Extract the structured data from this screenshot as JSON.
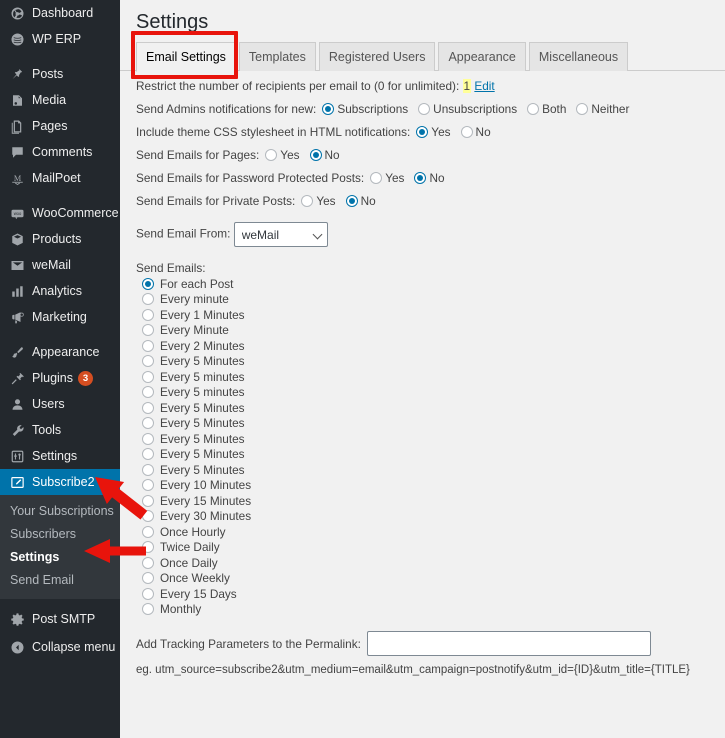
{
  "sidebar": {
    "items": [
      {
        "label": "Dashboard",
        "icon": "dashboard-icon",
        "badge": null
      },
      {
        "label": "WP ERP",
        "icon": "wperp-icon",
        "badge": null
      },
      {
        "sep": true
      },
      {
        "label": "Posts",
        "icon": "pin-icon",
        "badge": null
      },
      {
        "label": "Media",
        "icon": "media-icon",
        "badge": null
      },
      {
        "label": "Pages",
        "icon": "pages-icon",
        "badge": null
      },
      {
        "label": "Comments",
        "icon": "comments-icon",
        "badge": null
      },
      {
        "label": "MailPoet",
        "icon": "mailpoet-icon",
        "badge": null
      },
      {
        "sep": true
      },
      {
        "label": "WooCommerce",
        "icon": "woocommerce-icon",
        "badge": null
      },
      {
        "label": "Products",
        "icon": "products-icon",
        "badge": null
      },
      {
        "label": "weMail",
        "icon": "envelope-icon",
        "badge": null
      },
      {
        "label": "Analytics",
        "icon": "chart-bars-icon",
        "badge": null
      },
      {
        "label": "Marketing",
        "icon": "megaphone-icon",
        "badge": null
      },
      {
        "sep": true
      },
      {
        "label": "Appearance",
        "icon": "paintbrush-icon",
        "badge": null
      },
      {
        "label": "Plugins",
        "icon": "plug-icon",
        "badge": "3"
      },
      {
        "label": "Users",
        "icon": "user-icon",
        "badge": null
      },
      {
        "label": "Tools",
        "icon": "wrench-icon",
        "badge": null
      },
      {
        "label": "Settings",
        "icon": "sliders-icon",
        "badge": null
      },
      {
        "label": "Subscribe2",
        "icon": "pencil-square-icon",
        "badge": null,
        "current": true
      }
    ],
    "submenu": [
      {
        "label": "Your Subscriptions",
        "current": false
      },
      {
        "label": "Subscribers",
        "current": false
      },
      {
        "label": "Settings",
        "current": true
      },
      {
        "label": "Send Email",
        "current": false
      }
    ],
    "footer_items": [
      {
        "label": "Post SMTP",
        "icon": "gear-icon"
      },
      {
        "label": "Collapse menu",
        "icon": "collapse-icon"
      }
    ],
    "colors": {
      "bg": "#23282d",
      "submenu_bg": "#32373c",
      "current": "#0073aa",
      "badge": "#d54e21"
    }
  },
  "header": {
    "title": "Settings"
  },
  "tabs": [
    {
      "label": "Email Settings",
      "active": true
    },
    {
      "label": "Templates",
      "active": false
    },
    {
      "label": "Registered Users",
      "active": false
    },
    {
      "label": "Appearance",
      "active": false
    },
    {
      "label": "Miscellaneous",
      "active": false
    }
  ],
  "restrict": {
    "label": "Restrict the number of recipients per email to (0 for unlimited):",
    "value": "1",
    "edit_label": "Edit"
  },
  "option_rows": [
    {
      "label": "Send Admins notifications for new:",
      "options": [
        {
          "label": "Subscriptions",
          "checked": true
        },
        {
          "label": "Unsubscriptions",
          "checked": false
        },
        {
          "label": "Both",
          "checked": false
        },
        {
          "label": "Neither",
          "checked": false
        }
      ]
    },
    {
      "label": "Include theme CSS stylesheet in HTML notifications:",
      "options": [
        {
          "label": "Yes",
          "checked": true
        },
        {
          "label": "No",
          "checked": false
        }
      ]
    },
    {
      "label": "Send Emails for Pages:",
      "options": [
        {
          "label": "Yes",
          "checked": false
        },
        {
          "label": "No",
          "checked": true
        }
      ]
    },
    {
      "label": "Send Emails for Password Protected Posts:",
      "options": [
        {
          "label": "Yes",
          "checked": false
        },
        {
          "label": "No",
          "checked": true
        }
      ]
    },
    {
      "label": "Send Emails for Private Posts:",
      "options": [
        {
          "label": "Yes",
          "checked": false
        },
        {
          "label": "No",
          "checked": true
        }
      ]
    }
  ],
  "send_email_from": {
    "label": "Send Email From:",
    "selected": "weMail",
    "options": [
      "weMail"
    ]
  },
  "send_emails": {
    "label": "Send Emails:",
    "options": [
      {
        "label": "For each Post",
        "checked": true
      },
      {
        "label": "Every minute",
        "checked": false
      },
      {
        "label": "Every 1 Minutes",
        "checked": false
      },
      {
        "label": "Every Minute",
        "checked": false
      },
      {
        "label": "Every 2 Minutes",
        "checked": false
      },
      {
        "label": "Every 5 Minutes",
        "checked": false
      },
      {
        "label": "Every 5 minutes",
        "checked": false
      },
      {
        "label": "Every 5 minutes",
        "checked": false
      },
      {
        "label": "Every 5 Minutes",
        "checked": false
      },
      {
        "label": "Every 5 Minutes",
        "checked": false
      },
      {
        "label": "Every 5 Minutes",
        "checked": false
      },
      {
        "label": "Every 5 Minutes",
        "checked": false
      },
      {
        "label": "Every 5 Minutes",
        "checked": false
      },
      {
        "label": "Every 10 Minutes",
        "checked": false
      },
      {
        "label": "Every 15 Minutes",
        "checked": false
      },
      {
        "label": "Every 30 Minutes",
        "checked": false
      },
      {
        "label": "Once Hourly",
        "checked": false
      },
      {
        "label": "Twice Daily",
        "checked": false
      },
      {
        "label": "Once Daily",
        "checked": false
      },
      {
        "label": "Once Weekly",
        "checked": false
      },
      {
        "label": "Every 15 Days",
        "checked": false
      },
      {
        "label": "Monthly",
        "checked": false
      }
    ]
  },
  "tracking": {
    "label": "Add Tracking Parameters to the Permalink:",
    "value": "",
    "placeholder": "",
    "hint": "eg. utm_source=subscribe2&utm_medium=email&utm_campaign=postnotify&utm_id={ID}&utm_title={TITLE}"
  },
  "annotations": {
    "highlight_color": "#e8140c",
    "tab_box_target": "Email Settings",
    "arrow_targets": [
      "Subscribe2",
      "Settings"
    ]
  }
}
